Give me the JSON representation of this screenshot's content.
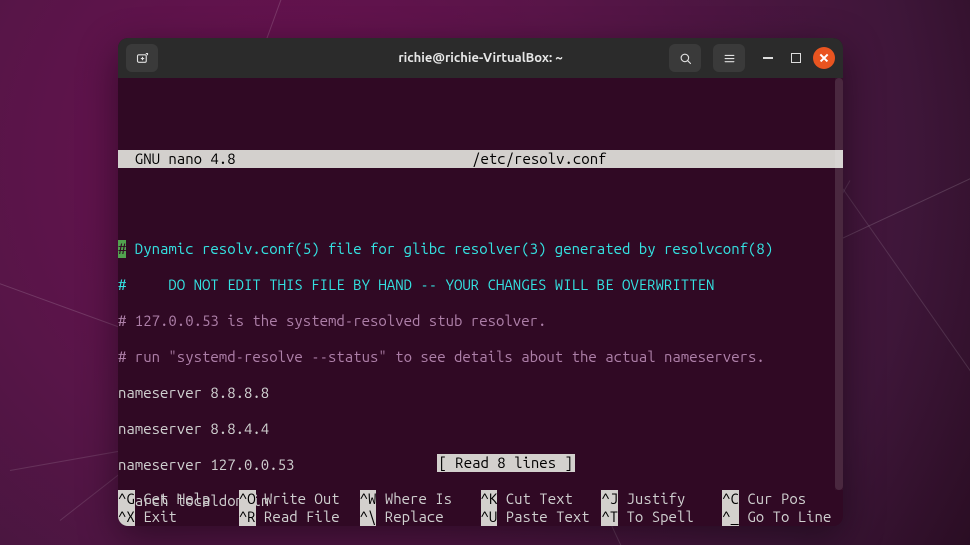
{
  "window": {
    "title": "richie@richie-VirtualBox: ~"
  },
  "editor": {
    "app": "  GNU nano 4.8",
    "file": "/etc/resolv.conf"
  },
  "content": {
    "lines": [
      " Dynamic resolv.conf(5) file for glibc resolver(3) generated by resolvconf(8)",
      "#     DO NOT EDIT THIS FILE BY HAND -- YOUR CHANGES WILL BE OVERWRITTEN",
      "# 127.0.0.53 is the systemd-resolved stub resolver.",
      "# run \"systemd-resolve --status\" to see details about the actual nameservers.",
      "nameserver 8.8.8.8",
      "nameserver 8.8.4.4",
      "nameserver 127.0.0.53",
      "search localdomain"
    ],
    "cursor_prefix": "#"
  },
  "status": "[ Read 8 lines ]",
  "shortcuts": {
    "row1": [
      {
        "key": "^G",
        "label": "Get Help"
      },
      {
        "key": "^O",
        "label": "Write Out"
      },
      {
        "key": "^W",
        "label": "Where Is"
      },
      {
        "key": "^K",
        "label": "Cut Text"
      },
      {
        "key": "^J",
        "label": "Justify"
      },
      {
        "key": "^C",
        "label": "Cur Pos"
      }
    ],
    "row2": [
      {
        "key": "^X",
        "label": "Exit"
      },
      {
        "key": "^R",
        "label": "Read File"
      },
      {
        "key": "^\\",
        "label": "Replace"
      },
      {
        "key": "^U",
        "label": "Paste Text"
      },
      {
        "key": "^T",
        "label": "To Spell"
      },
      {
        "key": "^_",
        "label": "Go To Line"
      }
    ]
  }
}
